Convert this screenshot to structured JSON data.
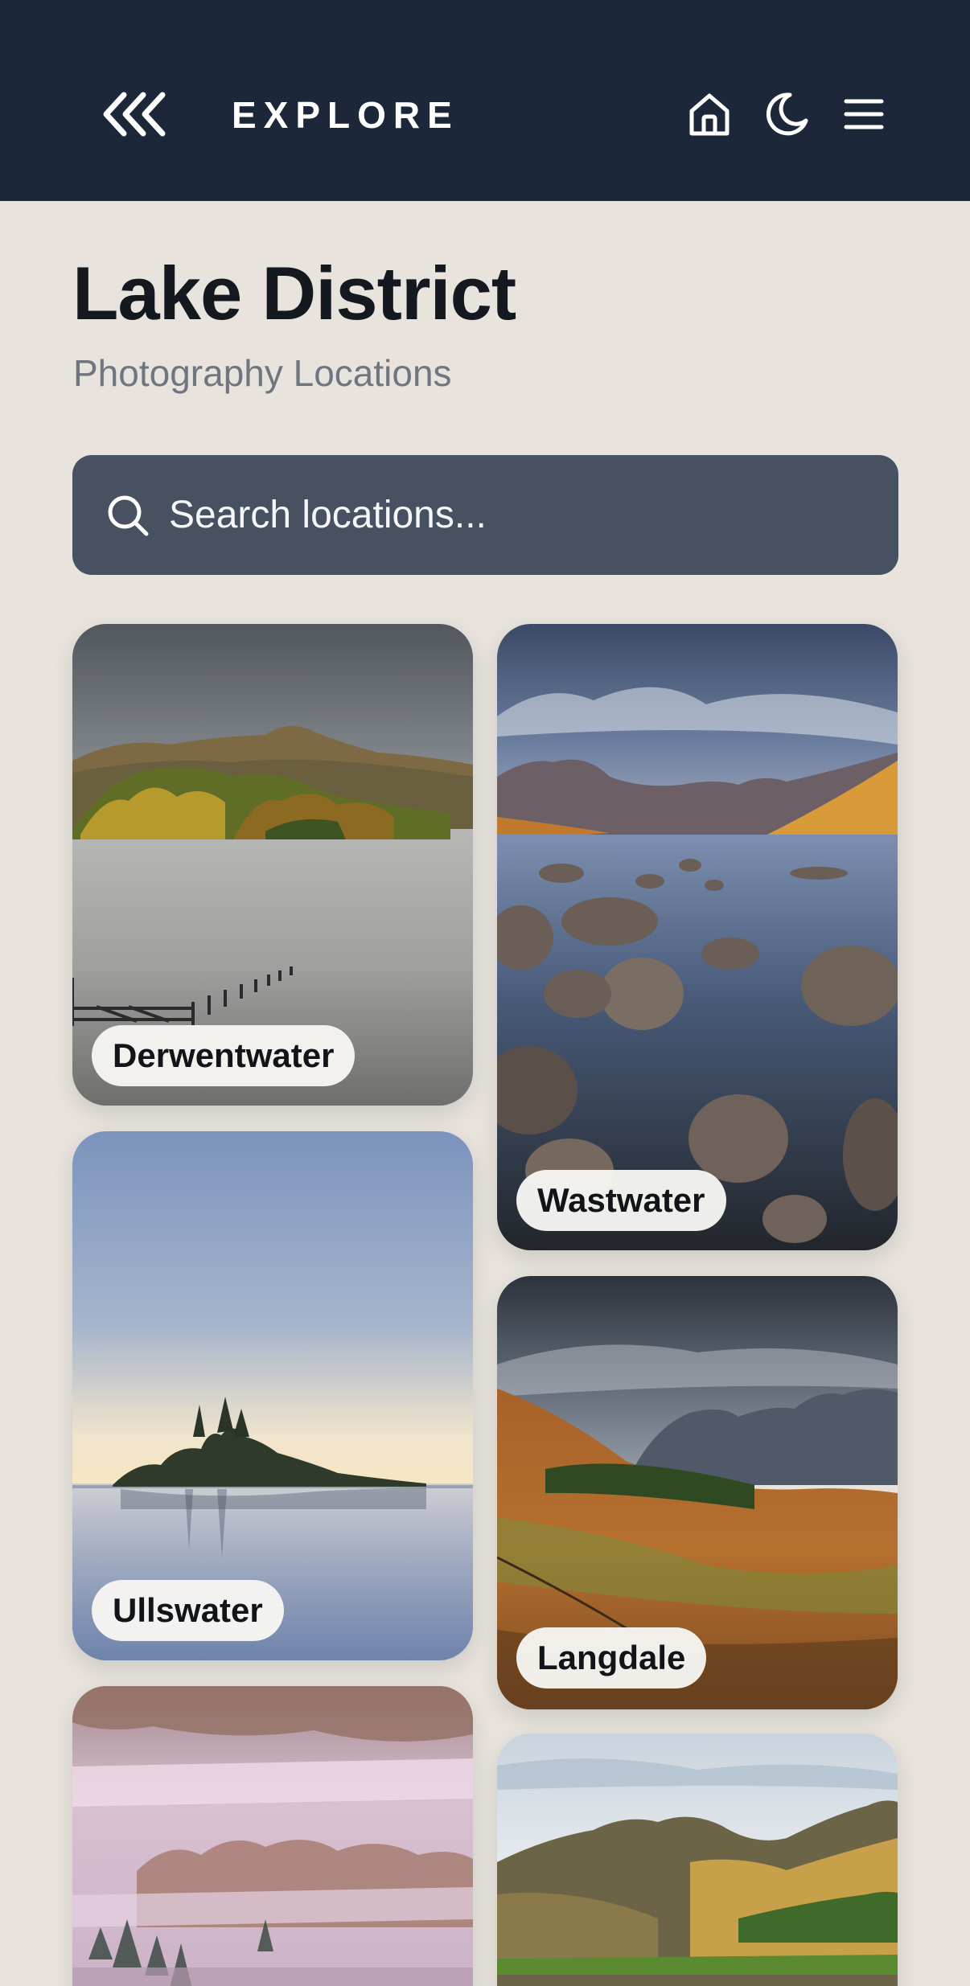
{
  "header": {
    "title": "EXPLORE",
    "icons": [
      "back-chevrons-icon",
      "home-icon",
      "moon-icon",
      "menu-icon"
    ],
    "background_color": "#1c283a"
  },
  "page": {
    "title": "Lake District",
    "subtitle": "Photography Locations"
  },
  "search": {
    "placeholder": "Search locations..."
  },
  "locations": [
    {
      "name": "Derwentwater"
    },
    {
      "name": "Wastwater"
    },
    {
      "name": "Ullswater"
    },
    {
      "name": "Langdale"
    },
    {
      "name": ""
    },
    {
      "name": ""
    }
  ]
}
